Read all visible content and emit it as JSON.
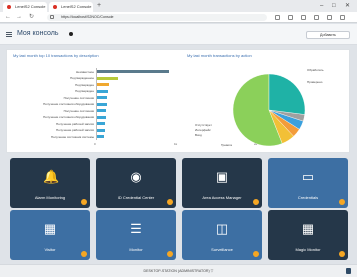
{
  "browser": {
    "tabs": [
      {
        "label": "LenelS2 Console",
        "icon_color": "#d93025"
      },
      {
        "label": "LenelS2 Console",
        "icon_color": "#d93025"
      }
    ],
    "new_tab": "+",
    "window_controls": [
      "–",
      "□",
      "✕"
    ],
    "url": "https://localhost/S2NOC/Console"
  },
  "header": {
    "title": "Моя консоль",
    "button_label": "Добавить"
  },
  "charts": {
    "left_title": "My last month top 10 transactions by description",
    "right_title": "My last month transactions by action"
  },
  "chart_data": [
    {
      "type": "bar",
      "orientation": "horizontal",
      "title": "My last month top 10 transactions by description",
      "categories": [
        "Неизвестное",
        "Подтвержденное",
        "Подтвержден",
        "Подтвержден",
        "Получение состояния",
        "Получение состояния оборудования",
        "Получение состояния",
        "Получение состояния оборудования",
        "Получение рабочей записи",
        "Получение рабочей записи",
        "Получение состояния системы"
      ],
      "values": [
        900,
        260,
        150,
        135,
        125,
        120,
        115,
        110,
        100,
        95,
        90
      ],
      "colors": [
        "#5a7a8c",
        "#b7c93a",
        "#f0a830",
        "#3aa6d6",
        "#3aa6d6",
        "#3aa6d6",
        "#3aa6d6",
        "#3aa6d6",
        "#3aa6d6",
        "#3aa6d6",
        "#3aa6d6"
      ],
      "x_ticks": [
        "0",
        "1k",
        "2k"
      ],
      "xlim": [
        0,
        2000
      ]
    },
    {
      "type": "pie",
      "title": "My last month transactions by action",
      "slices": [
        {
          "label": "Тревога",
          "value": 56,
          "color": "#8bd05a"
        },
        {
          "label": "Отсутствует",
          "value": 6,
          "color": "#f2c037"
        },
        {
          "label": "Интерфейс",
          "value": 4,
          "color": "#f39c3a"
        },
        {
          "label": "Вход",
          "value": 4,
          "color": "#3aa0dd"
        },
        {
          "label": "Обработать",
          "value": 3,
          "color": "#a0a0a0"
        },
        {
          "label": "Проверено",
          "value": 27,
          "color": "#1fb2a6"
        }
      ]
    }
  ],
  "tiles": [
    {
      "label": "Alarm Monitoring",
      "icon": "bell-icon",
      "style": "dark"
    },
    {
      "label": "ID Credential Center",
      "icon": "badge-icon",
      "style": "dark"
    },
    {
      "label": "Area Access Manager",
      "icon": "door-icon",
      "style": "dark"
    },
    {
      "label": "Credentials",
      "icon": "card-icon",
      "style": "blue"
    },
    {
      "label": "Visitor",
      "icon": "calendar-icon",
      "style": "blue"
    },
    {
      "label": "Monitor",
      "icon": "list-icon",
      "style": "blue"
    },
    {
      "label": "Surveillance",
      "icon": "camera-icon",
      "style": "blue"
    },
    {
      "label": "Magic Monitor",
      "icon": "grid-icon",
      "style": "dark"
    }
  ],
  "footer": {
    "text": "DESKTOP-STATION (ADMINISTRATOR) ▽"
  }
}
